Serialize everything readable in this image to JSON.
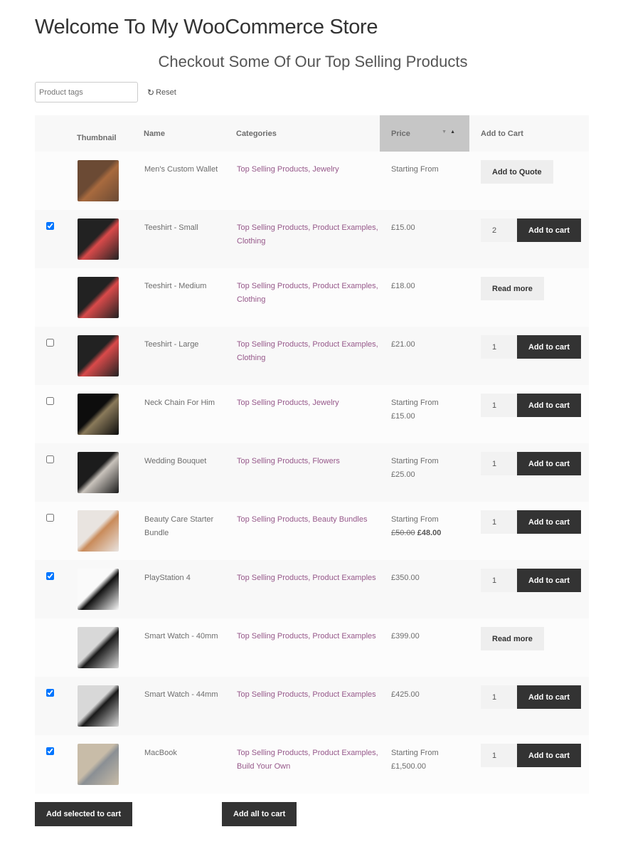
{
  "page": {
    "title": "Welcome To My WooCommerce Store",
    "subtitle": "Checkout Some Of Our Top Selling Products"
  },
  "filters": {
    "tags_placeholder": "Product tags",
    "reset_label": "Reset",
    "reset_icon": "refresh-icon"
  },
  "table": {
    "headers": {
      "select": "",
      "thumbnail": "Thumbnail",
      "name": "Name",
      "categories": "Categories",
      "price": "Price",
      "add_to_cart": "Add to Cart"
    },
    "sorted_column": "price",
    "sort_direction": "ascending",
    "rows": [
      {
        "checkbox": null,
        "thumb_colors": [
          "#6b4a34",
          "#a86a3e"
        ],
        "name": "Men's Custom Wallet",
        "categories": "Top Selling Products, Jewelry",
        "price_label": "Starting From",
        "price": "",
        "action": "Add to Quote",
        "qty": null
      },
      {
        "checkbox": true,
        "thumb_colors": [
          "#222",
          "#d94a4a"
        ],
        "name": "Teeshirt - Small",
        "categories": "Top Selling Products, Product Examples, Clothing",
        "price_label": "",
        "price": "£15.00",
        "action": "Add to cart",
        "qty": "2"
      },
      {
        "checkbox": null,
        "thumb_colors": [
          "#222",
          "#d94a4a"
        ],
        "name": "Teeshirt - Medium",
        "categories": "Top Selling Products, Product Examples, Clothing",
        "price_label": "",
        "price": "£18.00",
        "action": "Read more",
        "qty": null
      },
      {
        "checkbox": false,
        "thumb_colors": [
          "#222",
          "#d94a4a"
        ],
        "name": "Teeshirt - Large",
        "categories": "Top Selling Products, Product Examples, Clothing",
        "price_label": "",
        "price": "£21.00",
        "action": "Add to cart",
        "qty": "1"
      },
      {
        "checkbox": false,
        "thumb_colors": [
          "#0d0d0d",
          "#8a7a5a"
        ],
        "name": "Neck Chain For Him",
        "categories": "Top Selling Products, Jewelry",
        "price_label": "Starting From",
        "price": "£15.00",
        "action": "Add to cart",
        "qty": "1"
      },
      {
        "checkbox": false,
        "thumb_colors": [
          "#1c1c1c",
          "#c9c3bc"
        ],
        "name": "Wedding Bouquet",
        "categories": "Top Selling Products, Flowers",
        "price_label": "Starting From",
        "price": "£25.00",
        "action": "Add to cart",
        "qty": "1"
      },
      {
        "checkbox": false,
        "thumb_colors": [
          "#e9e4e0",
          "#c98b5a"
        ],
        "name": "Beauty Care Starter Bundle",
        "categories": "Top Selling Products, Beauty Bundles",
        "price_label": "Starting From",
        "price_old": "£50.00",
        "price": "£48.00",
        "action": "Add to cart",
        "qty": "1"
      },
      {
        "checkbox": true,
        "thumb_colors": [
          "#fafafa",
          "#111"
        ],
        "name": "PlayStation 4",
        "categories": "Top Selling Products, Product Examples",
        "price_label": "",
        "price": "£350.00",
        "action": "Add to cart",
        "qty": "1"
      },
      {
        "checkbox": null,
        "thumb_colors": [
          "#d8d8d8",
          "#1a1a1a"
        ],
        "name": "Smart Watch - 40mm",
        "categories": "Top Selling Products, Product Examples",
        "price_label": "",
        "price": "£399.00",
        "action": "Read more",
        "qty": null
      },
      {
        "checkbox": true,
        "thumb_colors": [
          "#d8d8d8",
          "#1a1a1a"
        ],
        "name": "Smart Watch - 44mm",
        "categories": "Top Selling Products, Product Examples",
        "price_label": "",
        "price": "£425.00",
        "action": "Add to cart",
        "qty": "1"
      },
      {
        "checkbox": true,
        "thumb_colors": [
          "#c8bca8",
          "#8a8f94"
        ],
        "name": "MacBook",
        "categories": "Top Selling Products, Product Examples, Build Your Own",
        "price_label": "Starting From",
        "price": "£1,500.00",
        "action": "Add to cart",
        "qty": "1"
      }
    ]
  },
  "footer": {
    "add_selected_label": "Add selected to cart",
    "add_all_label": "Add all to cart"
  }
}
